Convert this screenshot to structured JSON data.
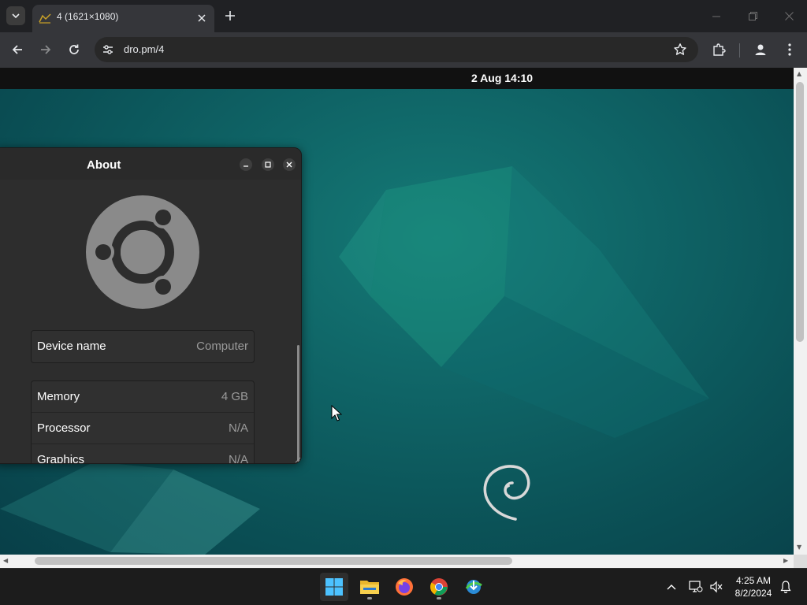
{
  "browser": {
    "tab_title": "4 (1621×1080)",
    "url": "dro.pm/4",
    "icons": [
      "tab-search-icon",
      "close-icon",
      "plus-icon",
      "minimize-icon",
      "restore-icon",
      "close-window-icon",
      "back-icon",
      "forward-icon",
      "reload-icon",
      "site-info-icon",
      "star-icon",
      "extensions-icon",
      "profile-icon",
      "more-icon"
    ]
  },
  "gnome": {
    "clock": "2 Aug 14:10"
  },
  "about_dialog": {
    "title": "About",
    "device": {
      "label": "Device name",
      "value": "Computer"
    },
    "specs": [
      {
        "label": "Memory",
        "value": "4 GB"
      },
      {
        "label": "Processor",
        "value": "N/A"
      },
      {
        "label": "Graphics",
        "value": "N/A"
      }
    ],
    "logo": "ubuntu-logo",
    "colors": {
      "window": "#2d2d2d",
      "logo": "#8a8a8a"
    }
  },
  "desktop": {
    "wallpaper_color": "#0f6466",
    "emblem": "debian-swirl"
  },
  "taskbar": {
    "apps": [
      "windows-start-icon",
      "file-explorer-icon",
      "firefox-icon",
      "chrome-icon",
      "idm-icon"
    ],
    "tray": {
      "time": "4:25 AM",
      "date": "8/2/2024"
    }
  }
}
